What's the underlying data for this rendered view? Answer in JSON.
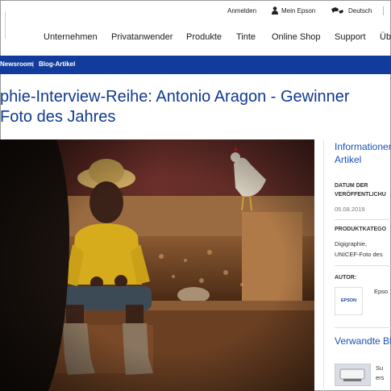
{
  "utility_nav": {
    "login": "Anmelden",
    "my_epson": "Mein Epson",
    "language": "Deutsch"
  },
  "main_nav": {
    "items": [
      "Unternehmen",
      "Privatanwender",
      "Produkte",
      "Tinte",
      "Online Shop",
      "Support",
      "Üb"
    ]
  },
  "breadcrumb": {
    "items": [
      "Newsroom",
      "Blog-Artikel"
    ],
    "separator": "|"
  },
  "article": {
    "title_line1": "phie-Interview-Reihe: Antonio Aragon - Gewinner",
    "title_line2": "Foto des Jahres"
  },
  "sidebar": {
    "info_heading_line1": "Informationen",
    "info_heading_line2": "Artikel",
    "date_label_line1": "DATUM DER",
    "date_label_line2": "VERÖFFENTLICHU",
    "date_value": "05.08.2019",
    "category_label": "PRODUKTKATEGO",
    "category_line1": "Digigraphie,",
    "category_line2": "UNICEF-Foto des",
    "author_label": "AUTOR:",
    "author_logo_text": "EPSON",
    "author_name": "Epso",
    "related_heading": "Verwandte Bl",
    "related_snippet_line1": "Su",
    "related_snippet_line2": "ers"
  },
  "colors": {
    "accent_blue": "#123c9c",
    "title_blue": "#0f3a8f",
    "link_blue": "#1a52b8"
  }
}
